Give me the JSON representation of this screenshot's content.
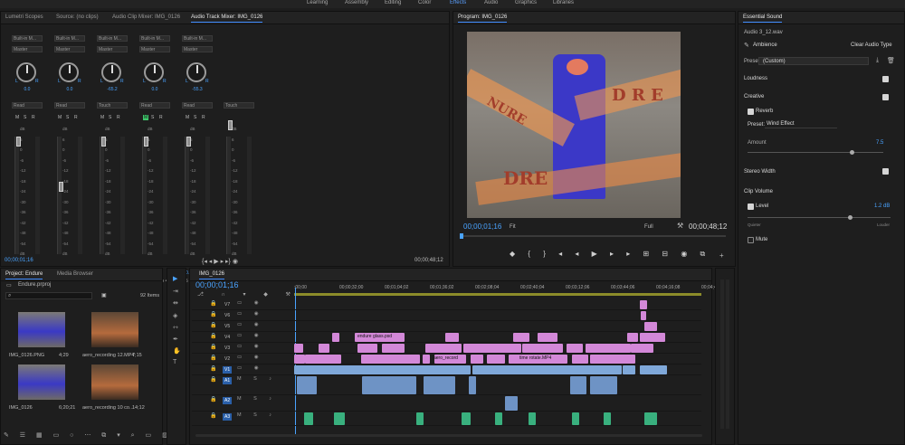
{
  "workspaces": [
    "Learning",
    "Assembly",
    "Editing",
    "Color",
    "Effects",
    "Audio",
    "Graphics",
    "Libraries"
  ],
  "active_workspace": "Effects",
  "left_panel": {
    "tabs": [
      "Lumetri Scopes",
      "Source: (no clips)",
      "Audio Clip Mixer: IMG_0126",
      "Audio Track Mixer: IMG_0126"
    ],
    "active_tab": "Audio Track Mixer: IMG_0126",
    "channels": [
      {
        "input": "Built-in M...",
        "output": "Master",
        "pan": "0.0",
        "mode": "Read",
        "msr": [
          "M",
          "S",
          "R"
        ],
        "value": "0.0",
        "name": "A1",
        "label": "Audio 1"
      },
      {
        "input": "Built-in M...",
        "output": "Master",
        "pan": "0.0",
        "mode": "Read",
        "msr": [
          "M",
          "S",
          "R"
        ],
        "value": "-12.0",
        "name": "A2",
        "label": "Audio 2"
      },
      {
        "input": "Built-in M...",
        "output": "Master",
        "pan": "-65.2",
        "mode": "Touch",
        "msr": [
          "M",
          "S",
          "R"
        ],
        "value": "0.0",
        "name": "A3",
        "label": "Audio 3"
      },
      {
        "input": "Built-in M...",
        "output": "Master",
        "pan": "0.0",
        "mode": "Read",
        "msr": [
          "M",
          "S",
          "R"
        ],
        "value": "0.0",
        "name": "A4",
        "label": "Audio 4"
      },
      {
        "input": "Built-in M...",
        "output": "Master",
        "pan": "-55.3",
        "mode": "Read",
        "msr": [
          "M",
          "S",
          "R"
        ],
        "value": "0.0",
        "name": "A5",
        "label": "Audio 5"
      },
      {
        "input": "",
        "output": "",
        "pan": "",
        "mode": "Touch",
        "msr": [],
        "value": "0.0",
        "name": "",
        "label": "Master"
      }
    ],
    "db_scale": [
      "dB",
      "6",
      "0",
      "-6",
      "-12",
      "-18",
      "-24",
      "-30",
      "-36",
      "-42",
      "-48",
      "-54",
      "dB"
    ],
    "lr": [
      "L",
      "R"
    ],
    "timecode_left": "00;00;01;16",
    "timecode_right": "00;00;48;12"
  },
  "program": {
    "title": "Program: IMG_0126",
    "timecode": "00;00;01;16",
    "fit": "Fit",
    "quality": "Full",
    "duration": "00;00;48;12",
    "overlay_text": [
      "DRE",
      "D R E",
      "NURE"
    ]
  },
  "essential_sound": {
    "title": "Essential Sound",
    "clip": "Audio 3_12.wav",
    "type": "Ambience",
    "clear_label": "Clear Audio Type",
    "preset_label": "Preset:",
    "preset_value": "(Custom)",
    "sections": [
      "Loudness",
      "Creative",
      "Stereo Width",
      "Clip Volume"
    ],
    "reverb_label": "Reverb",
    "reverb_preset_label": "Preset:",
    "reverb_preset_value": "Wind Effect",
    "amount_label": "Amount",
    "amount_value": "7.5",
    "amount_level": 0.75,
    "level_label": "Level",
    "level_value": "1.2 dB",
    "level_fraction": 0.7,
    "quieter": "Quieter",
    "louder": "Louder",
    "mute_label": "Mute"
  },
  "project": {
    "tabs": [
      "Project: Endure",
      "Media Browser"
    ],
    "file": "Endure.prproj",
    "items_count": "92 Items",
    "items": [
      {
        "name": "IMG_0126.PNG",
        "duration": "4;29"
      },
      {
        "name": "aero_recording 12.MP4",
        "duration": "7;15"
      },
      {
        "name": "IMG_0126",
        "duration": "6;20;21"
      },
      {
        "name": "aero_recording 10 co...",
        "duration": "14;12"
      }
    ]
  },
  "timeline": {
    "sequence": "IMG_0126",
    "timecode": "00;00;01;16",
    "ruler": [
      ":00;00",
      "00;00;32;00",
      "00;01;04;02",
      "00;01;36;02",
      "00;02;08;04",
      "00;02;40;04",
      "00;03;12;06",
      "00;03;44;06",
      "00;04;16;08",
      "00;04;48"
    ],
    "video_tracks": [
      "V7",
      "V6",
      "V5",
      "V4",
      "V3",
      "V2",
      "V1"
    ],
    "audio_tracks": [
      "A1",
      "A2",
      "A3"
    ],
    "clip_labels": [
      "endure glass.psd",
      "aero_record",
      "time rotate.MP4"
    ]
  }
}
